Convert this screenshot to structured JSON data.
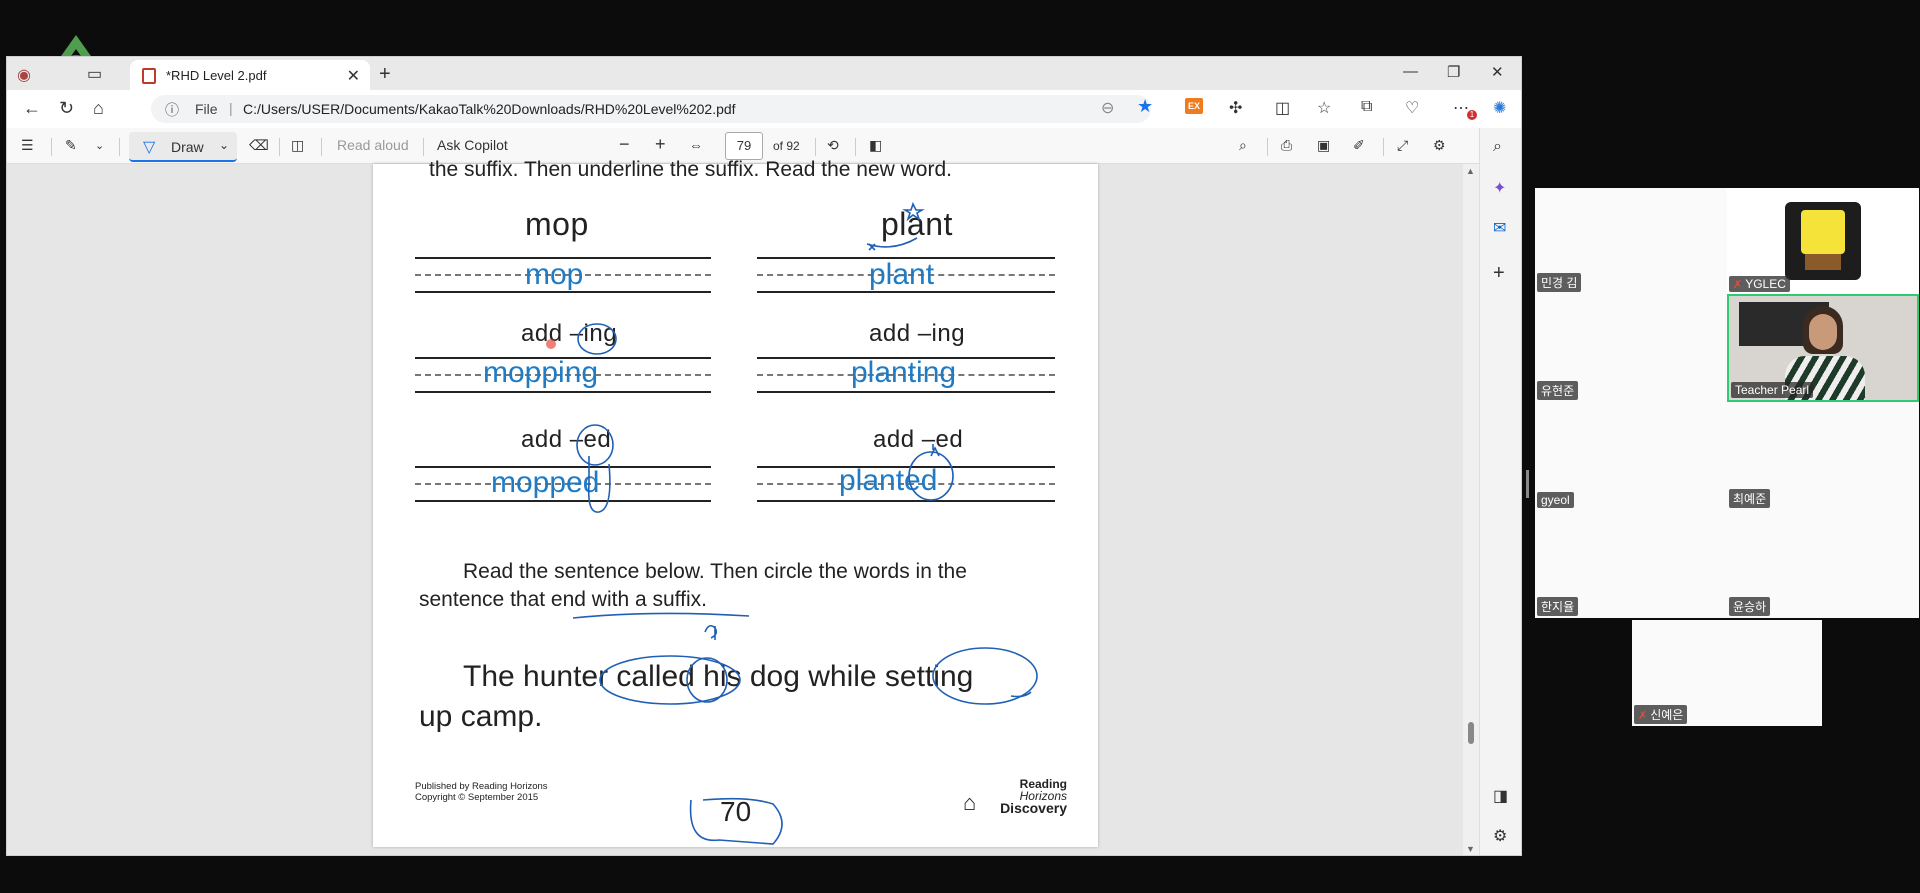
{
  "browser": {
    "tab_title": "*RHD Level 2.pdf",
    "tab_close": "✕",
    "new_tab": "+",
    "win_min": "—",
    "win_max": "❐",
    "win_close": "✕",
    "url_file_label": "File",
    "url": "C:/Users/USER/Documents/KakaoTalk%20Downloads/RHD%20Level%202.pdf",
    "notif_count": "1",
    "ext_badge": "EX"
  },
  "pdf_toolbar": {
    "draw_label": "Draw",
    "read_aloud": "Read aloud",
    "ask_copilot": "Ask Copilot",
    "zoom_out": "−",
    "zoom_in": "+",
    "page_current": "79",
    "page_total": "of 92"
  },
  "page": {
    "top_instruction": "the suffix. Then underline the suffix. Read the new word.",
    "base_left": "mop",
    "base_right": "plant",
    "answer_base_left": "mop",
    "answer_base_right": "plant",
    "add_ing_left": "add –ing",
    "add_ing_right": "add –ing",
    "answer_ing_left": "mopping",
    "answer_ing_right": "planting",
    "add_ed_left": "add –ed",
    "add_ed_right": "add –ed",
    "answer_ed_left": "mopped",
    "answer_ed_right": "planted",
    "instruction_line1": "Read the sentence below. Then circle the words in the",
    "instruction_line2": "sentence that end with a suffix.",
    "sentence_line1": "The hunter called his dog while setting",
    "sentence_line2": "up camp.",
    "footer_line1": "Published by Reading Horizons",
    "footer_line2": "Copyright © September 2015",
    "logo_line1": "Reading",
    "logo_line2": "Horizons",
    "logo_line3": "Discovery",
    "page_number": "70"
  },
  "participants": [
    {
      "name": "민경 김",
      "muted": false
    },
    {
      "name": "YGLEC",
      "muted": true
    },
    {
      "name": "유현준",
      "muted": false
    },
    {
      "name": "Teacher Pearl",
      "muted": false
    },
    {
      "name": "gyeol",
      "muted": false
    },
    {
      "name": "최예준",
      "muted": false
    },
    {
      "name": "한지율",
      "muted": false
    },
    {
      "name": "윤승하",
      "muted": false
    },
    {
      "name": "신예은",
      "muted": true
    }
  ],
  "colors": {
    "accent": "#1a73e8",
    "ink_blue": "#1f7bc4",
    "active_speaker": "#2ecc71"
  }
}
